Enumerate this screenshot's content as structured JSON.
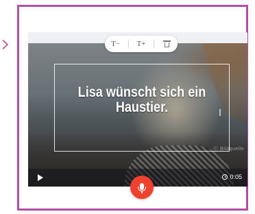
{
  "editor": {
    "toolbar": {
      "decrease_text_label": "T−",
      "increase_text_label": "T+",
      "delete_icon": "trash-icon"
    },
    "caption": {
      "text": "Lisa wünscht sich ein Haustier."
    },
    "watermark": "ⓒ Bildquelle",
    "controls": {
      "play_icon": "play-icon",
      "record_icon": "microphone-icon",
      "duration": "0:05"
    }
  },
  "colors": {
    "frame_border": "#b14fa6",
    "record_button": "#f0412f"
  }
}
